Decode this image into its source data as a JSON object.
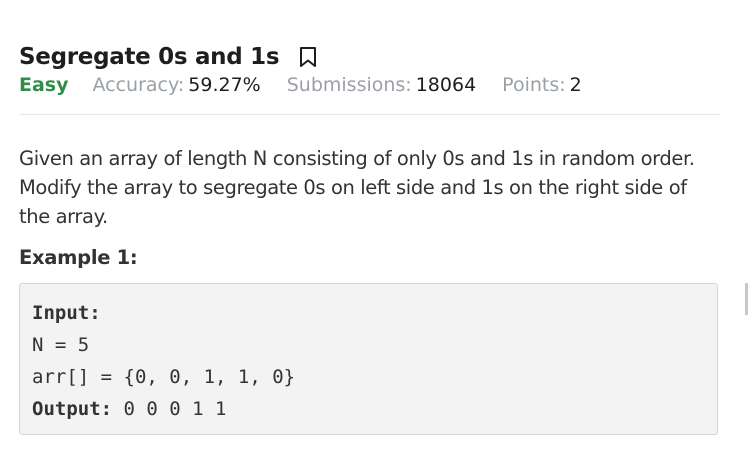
{
  "problem": {
    "title": "Segregate 0s and 1s",
    "difficulty": "Easy",
    "accuracy_label": "Accuracy:",
    "accuracy_value": "59.27%",
    "submissions_label": "Submissions:",
    "submissions_value": "18064",
    "points_label": "Points:",
    "points_value": "2",
    "description": "Given an array of length N consisting of only 0s and 1s in random order. Modify the array to segregate 0s on left side and 1s on the right side of the array.",
    "example_heading": "Example 1:",
    "example": {
      "input_label": "Input:",
      "line_n": "N = 5",
      "line_arr": "arr[] = {0, 0, 1, 1, 0}",
      "output_label": "Output:",
      "output_value": " 0 0 0 1 1"
    }
  },
  "icons": {
    "bookmark": "bookmark-icon"
  },
  "colors": {
    "difficulty_easy": "#2f8d46",
    "meta_label": "#9aa0a6",
    "code_background": "#f3f3f3"
  }
}
